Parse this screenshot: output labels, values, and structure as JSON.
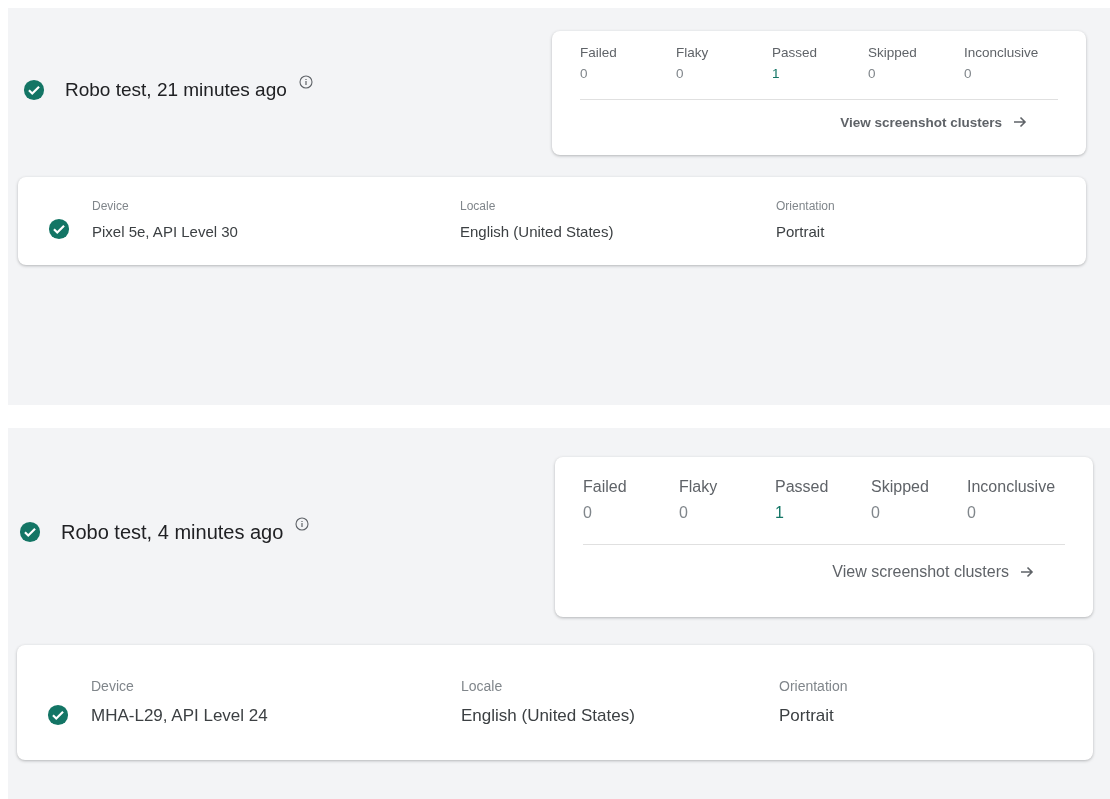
{
  "runs": [
    {
      "passed": true,
      "title": "Robo test, 21 minutes ago",
      "counters": [
        {
          "label": "Failed",
          "value": "0",
          "color": "#80868b"
        },
        {
          "label": "Flaky",
          "value": "0",
          "color": "#80868b"
        },
        {
          "label": "Passed",
          "value": "1",
          "color": "#137565"
        },
        {
          "label": "Skipped",
          "value": "0",
          "color": "#80868b"
        },
        {
          "label": "Inconclusive",
          "value": "0",
          "color": "#80868b"
        }
      ],
      "link": "View screenshot clusters",
      "device": {
        "passed": true,
        "columns": [
          {
            "label": "Device",
            "value": "Pixel 5e, API Level 30"
          },
          {
            "label": "Locale",
            "value": "English (United States)"
          },
          {
            "label": "Orientation",
            "value": "Portrait"
          }
        ]
      }
    },
    {
      "passed": true,
      "title": "Robo test, 4 minutes ago",
      "counters": [
        {
          "label": "Failed",
          "value": "0",
          "color": "#80868b"
        },
        {
          "label": "Flaky",
          "value": "0",
          "color": "#80868b"
        },
        {
          "label": "Passed",
          "value": "1",
          "color": "#137565"
        },
        {
          "label": "Skipped",
          "value": "0",
          "color": "#80868b"
        },
        {
          "label": "Inconclusive",
          "value": "0",
          "color": "#80868b"
        }
      ],
      "link": "View screenshot clusters",
      "device": {
        "passed": true,
        "columns": [
          {
            "label": "Device",
            "value": "MHA-L29, API Level 24"
          },
          {
            "label": "Locale",
            "value": "English (United States)"
          },
          {
            "label": "Orientation",
            "value": "Portrait"
          }
        ]
      }
    }
  ]
}
